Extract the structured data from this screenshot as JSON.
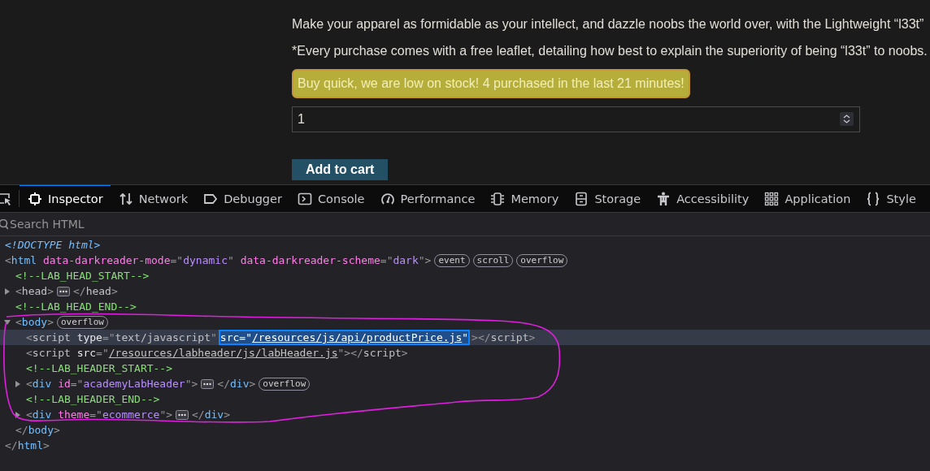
{
  "product": {
    "paragraphs": [
      "Make your apparel as formidable as your intellect, and dazzle noobs the world over, with the Lightweight “l33t”",
      "*Every purchase comes with a free leaflet, detailing how best to explain the superiority of being “l33t” to noobs."
    ],
    "stock_alert": "Buy quick, we are low on stock! 4 purchased in the last 21 minutes!",
    "quantity": {
      "value": "1"
    },
    "add_button": "Add to cart"
  },
  "devtools": {
    "tabs": [
      {
        "label": "Inspector",
        "selected": true
      },
      {
        "label": "Network",
        "selected": false
      },
      {
        "label": "Debugger",
        "selected": false
      },
      {
        "label": "Console",
        "selected": false
      },
      {
        "label": "Performance",
        "selected": false
      },
      {
        "label": "Memory",
        "selected": false
      },
      {
        "label": "Storage",
        "selected": false
      },
      {
        "label": "Accessibility",
        "selected": false
      },
      {
        "label": "Application",
        "selected": false
      },
      {
        "label": "Style",
        "selected": false
      }
    ],
    "search": {
      "placeholder": "Search HTML"
    },
    "nodes": [
      {
        "kind": "doctype",
        "text": "<!DOCTYPE html>"
      },
      {
        "kind": "element",
        "open": "<html",
        "attrs": [
          {
            "text": "data-darkreader-mode=\"dynamic\""
          },
          {
            "text": "data-darkreader-scheme=\"dark\""
          }
        ],
        "open_end": ">",
        "badges": [
          "event",
          "scroll",
          "overflow"
        ],
        "close": "</html>",
        "children": [
          {
            "kind": "comment",
            "text": "<!--LAB_HEAD_START-->"
          },
          {
            "kind": "element",
            "open": "<head",
            "open_end": ">",
            "close": "</head>",
            "expanded": false,
            "hidden": true
          },
          {
            "kind": "comment",
            "text": "<!--LAB_HEAD_END-->"
          },
          {
            "kind": "element",
            "open": "<body",
            "open_end": ">",
            "badges": [
              "overflow"
            ],
            "close": "</body>",
            "expanded": true,
            "children": [
              {
                "kind": "element",
                "open": "<script",
                "attrs": [
                  {
                    "text": "type=\"text/javascript\"",
                    "selected": false
                  },
                  {
                    "text": "src=\"/resources/js/api/productPrice.js\"",
                    "link": true,
                    "selected": true
                  }
                ],
                "open_end": "></script>",
                "hidden": true,
                "selected": true
              },
              {
                "kind": "element",
                "open": "<script",
                "attrs": [
                  {
                    "text": "src=\"/resources/labheader/js/labHeader.js\"",
                    "link": true,
                    "selected": false
                  }
                ],
                "open_end": "></script>",
                "hidden": true,
                "selected": false
              },
              {
                "kind": "comment",
                "text": "<!--LAB_HEADER_START-->"
              },
              {
                "kind": "element",
                "open": "<div",
                "attrs": [
                  {
                    "text": "id=\"academyLabHeader\""
                  }
                ],
                "open_end": ">",
                "close": "</div>",
                "expanded": false,
                "badges": [
                  "overflow"
                ]
              },
              {
                "kind": "comment",
                "text": "<!--LAB_HEADER_END-->"
              },
              {
                "kind": "element",
                "open": "<div",
                "attrs": [
                  {
                    "text": "theme=\"ecommerce\""
                  }
                ],
                "open_end": ">",
                "close": "</div>",
                "expanded": false
              }
            ]
          }
        ]
      }
    ]
  }
}
